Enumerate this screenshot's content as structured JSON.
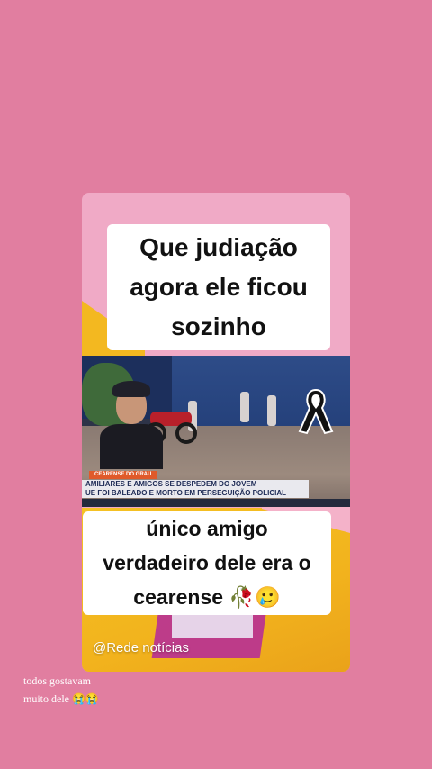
{
  "story": {
    "caption_top": [
      "Que judiação",
      "agora ele ficou",
      "sozinho"
    ],
    "caption_bottom": [
      "único amigo",
      "verdadeiro dele era o",
      "cearense"
    ],
    "caption_bottom_emoji": "🥀🥲",
    "watermark": "@Rede notícias",
    "side_text": [
      "todos gostavam",
      "muito dele 😭😭"
    ]
  },
  "video": {
    "tag": "CEARENSE DO GRAU",
    "headline": [
      "AMILIARES E AMIGOS SE DESPEDEM DO JOVEM",
      "UE FOI BALEADO E MORTO EM PERSEGUIÇÃO POLICIAL"
    ],
    "icon": "mourning-ribbon-icon"
  },
  "colors": {
    "background": "#e17ea0",
    "card_pink": "#f0aac6",
    "card_yellow": "#f2b31d",
    "caption_bg": "#ffffff"
  }
}
